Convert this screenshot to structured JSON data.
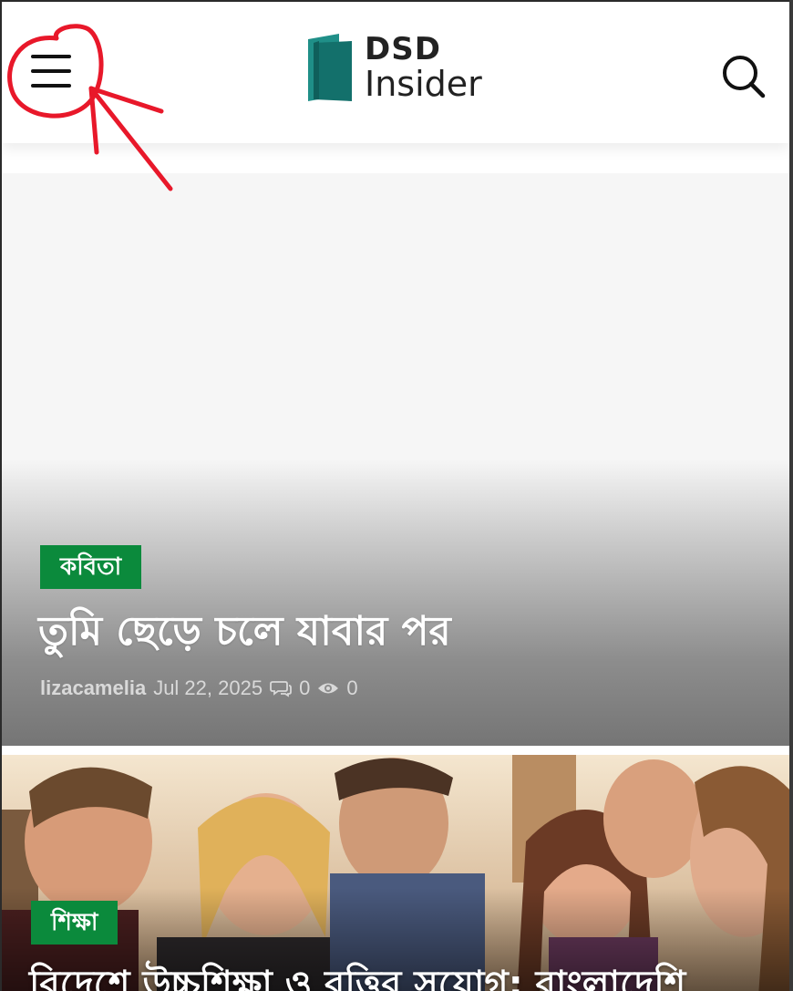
{
  "header": {
    "logo_line1": "DSD",
    "logo_line2": "Insider"
  },
  "featured_post": {
    "category": "কবিতা",
    "title": "তুমি ছেড়ে চলে যাবার পর",
    "author": "lizacamelia",
    "date": "Jul 22, 2025",
    "comments": "0",
    "views": "0"
  },
  "second_post": {
    "category": "শিক্ষা",
    "title": "বিদেশে উচ্চশিক্ষা ও বৃত্তির সুযোগ: বাংলাদেশি"
  },
  "colors": {
    "category_badge": "#0b8a3c",
    "logo_teal": "#1a7f7a",
    "annotation": "#e8182a"
  },
  "icons": {
    "menu": "hamburger-menu-icon",
    "search": "search-icon",
    "comments": "comments-icon",
    "views": "eye-icon"
  }
}
